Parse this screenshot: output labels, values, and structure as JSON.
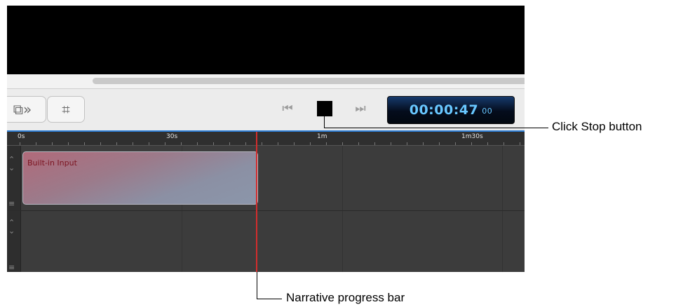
{
  "toolbar": {
    "arrange_icon": "arrange-overflow-icon",
    "arrange_glyph": "⧉»",
    "crop_icon": "crop-icon",
    "crop_glyph": "⌗",
    "rewind_icon": "skip-back-icon",
    "rewind_glyph": "⏮",
    "stop_icon": "stop-icon",
    "forward_icon": "skip-forward-icon",
    "forward_glyph": "⏭"
  },
  "timecode": {
    "time": "00:00:47",
    "frames": "00"
  },
  "ruler": {
    "labels": [
      "0s",
      "30s",
      "1m",
      "1m30s"
    ]
  },
  "tracks": [
    {
      "clip_label": "Built-in Input"
    },
    {
      "clip_label": ""
    }
  ],
  "annotations": {
    "stop": "Click Stop button",
    "progress": "Narrative progress bar"
  },
  "colors": {
    "playhead": "#d22d2d",
    "timecode_text": "#68c7ff",
    "ruler_accent": "#2f7fd6"
  }
}
